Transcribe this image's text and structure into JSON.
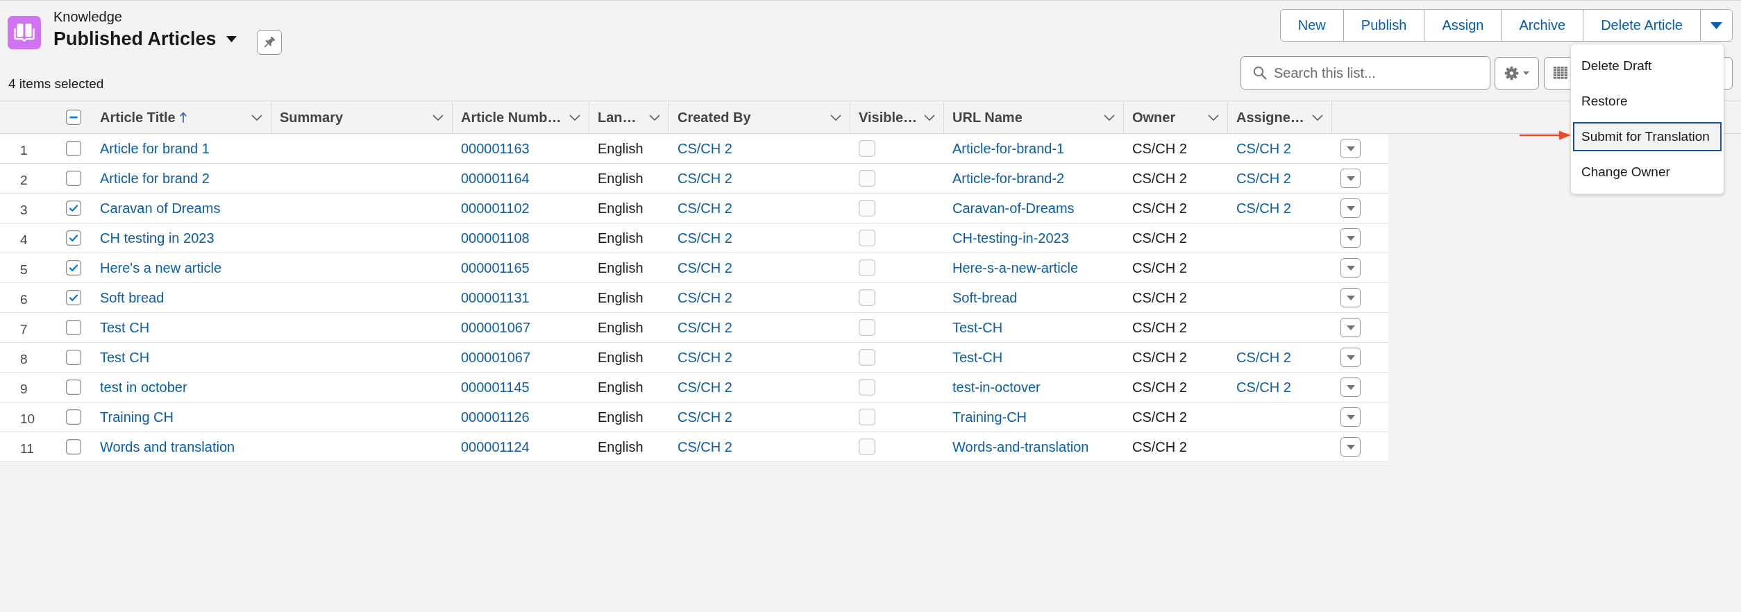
{
  "app": {
    "name": "Knowledge",
    "list_title": "Published Articles"
  },
  "status": "4 items selected",
  "actions": [
    "New",
    "Publish",
    "Assign",
    "Archive",
    "Delete Article"
  ],
  "actions_menu": {
    "expanded": true,
    "items": [
      {
        "label": "Delete Draft",
        "selected": false
      },
      {
        "label": "Restore",
        "selected": false
      },
      {
        "label": "Submit for Translation",
        "selected": true
      },
      {
        "label": "Change Owner",
        "selected": false
      }
    ]
  },
  "search": {
    "placeholder": "Search this list..."
  },
  "table": {
    "select_all": {
      "indeterminate": true
    },
    "columns": [
      {
        "label": "Article Title",
        "kind": "link",
        "sorted": true
      },
      {
        "label": "Summary",
        "kind": "text",
        "sorted": false
      },
      {
        "label": "Article Numb…",
        "kind": "link",
        "sorted": false
      },
      {
        "label": "Lan…",
        "kind": "text",
        "sorted": false
      },
      {
        "label": "Created By",
        "kind": "link",
        "sorted": false
      },
      {
        "label": "Visible…",
        "kind": "checkbox",
        "sorted": false
      },
      {
        "label": "URL Name",
        "kind": "link",
        "sorted": false
      },
      {
        "label": "Owner",
        "kind": "text",
        "sorted": false
      },
      {
        "label": "Assigne…",
        "kind": "link",
        "sorted": false
      }
    ],
    "rows": [
      {
        "number": "1",
        "selected": false,
        "cells": [
          "Article for brand 1",
          null,
          "000001163",
          "English",
          "CS/CH 2",
          {
            "checked": false
          },
          "Article-for-brand-1",
          "CS/CH 2",
          "CS/CH 2"
        ]
      },
      {
        "number": "2",
        "selected": false,
        "cells": [
          "Article for brand 2",
          null,
          "000001164",
          "English",
          "CS/CH 2",
          {
            "checked": false
          },
          "Article-for-brand-2",
          "CS/CH 2",
          "CS/CH 2"
        ]
      },
      {
        "number": "3",
        "selected": true,
        "cells": [
          "Caravan of Dreams",
          null,
          "000001102",
          "English",
          "CS/CH 2",
          {
            "checked": false
          },
          "Caravan-of-Dreams",
          "CS/CH 2",
          "CS/CH 2"
        ]
      },
      {
        "number": "4",
        "selected": true,
        "cells": [
          "CH testing in 2023",
          null,
          "000001108",
          "English",
          "CS/CH 2",
          {
            "checked": false
          },
          "CH-testing-in-2023",
          "CS/CH 2",
          null
        ]
      },
      {
        "number": "5",
        "selected": true,
        "cells": [
          "Here's a new article",
          null,
          "000001165",
          "English",
          "CS/CH 2",
          {
            "checked": false
          },
          "Here-s-a-new-article",
          "CS/CH 2",
          null
        ]
      },
      {
        "number": "6",
        "selected": true,
        "cells": [
          "Soft bread",
          null,
          "000001131",
          "English",
          "CS/CH 2",
          {
            "checked": false
          },
          "Soft-bread",
          "CS/CH 2",
          null
        ]
      },
      {
        "number": "7",
        "selected": false,
        "cells": [
          "Test CH",
          null,
          "000001067",
          "English",
          "CS/CH 2",
          {
            "checked": false
          },
          "Test-CH",
          "CS/CH 2",
          null
        ]
      },
      {
        "number": "8",
        "selected": false,
        "cells": [
          "Test CH",
          null,
          "000001067",
          "English",
          "CS/CH 2",
          {
            "checked": false
          },
          "Test-CH",
          "CS/CH 2",
          "CS/CH 2"
        ]
      },
      {
        "number": "9",
        "selected": false,
        "cells": [
          "test in october",
          null,
          "000001145",
          "English",
          "CS/CH 2",
          {
            "checked": false
          },
          "test-in-octover",
          "CS/CH 2",
          "CS/CH 2"
        ]
      },
      {
        "number": "10",
        "selected": false,
        "cells": [
          "Training CH",
          null,
          "000001126",
          "English",
          "CS/CH 2",
          {
            "checked": false
          },
          "Training-CH",
          "CS/CH 2",
          null
        ]
      },
      {
        "number": "11",
        "selected": false,
        "cells": [
          "Words and translation",
          null,
          "000001124",
          "English",
          "CS/CH 2",
          {
            "checked": false
          },
          "Words-and-translation",
          "CS/CH 2",
          null
        ]
      }
    ]
  }
}
